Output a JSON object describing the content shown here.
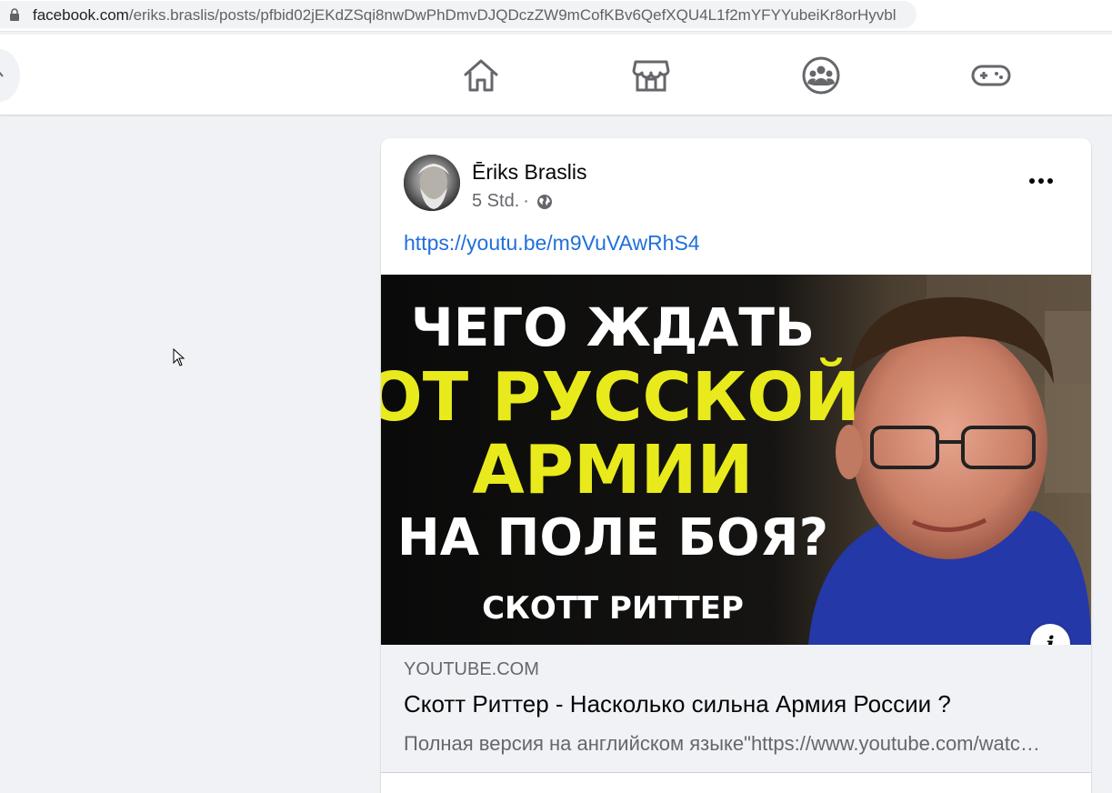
{
  "browser": {
    "url_host": "facebook.com",
    "url_path": "/eriks.braslis/posts/pfbid02jEKdZSqi8nwDwPhDmvDJQDczZW9mCofKBv6QefXQU4L1f2mYFYYubeiKr8orHyvbl"
  },
  "nav": {
    "icons": [
      "home-icon",
      "marketplace-icon",
      "groups-icon",
      "gaming-icon"
    ]
  },
  "post": {
    "author": "Ēriks Braslis",
    "time": "5 Std.",
    "separator": "·",
    "link_text": "https://youtu.be/m9VuVAwRhS4",
    "thumbnail": {
      "line1": "ЧЕГО ЖДАТЬ",
      "line2": "ОТ РУССКОЙ",
      "line3": "АРМИИ",
      "line4": "НА ПОЛЕ БОЯ?",
      "line5": "СКОТТ РИТТЕР",
      "text_white": "#ffffff",
      "text_yellow": "#e8ea1c"
    },
    "info_label": "i",
    "preview": {
      "domain": "YOUTUBE.COM",
      "title": "Скотт Риттер - Насколько сильна Армия России ?",
      "description": "Полная версия на английском языке\"https://www.youtube.com/watch?v=..."
    }
  },
  "colors": {
    "link": "#216fdb",
    "secondary_text": "#65676b",
    "background": "#f0f2f5"
  }
}
